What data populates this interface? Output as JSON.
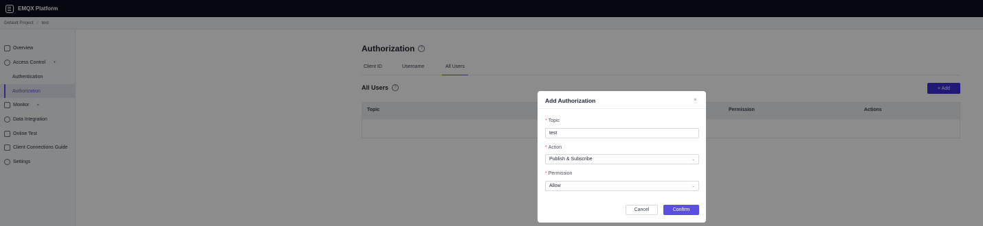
{
  "app": {
    "brand": "EMQX Platform"
  },
  "breadcrumb": [
    "Default Project",
    "test"
  ],
  "sidebar": {
    "items": [
      {
        "label": "Overview",
        "icon": "overview-icon"
      },
      {
        "label": "Access Control",
        "icon": "shield-icon",
        "caret": "▾"
      },
      {
        "label": "Authentication"
      },
      {
        "label": "Authorization",
        "active": true
      },
      {
        "label": "Monitor",
        "icon": "monitor-icon",
        "caret": "▸"
      },
      {
        "label": "Data Integration",
        "icon": "integration-icon"
      },
      {
        "label": "Online Test",
        "icon": "test-icon"
      },
      {
        "label": "Client Connections Guide",
        "icon": "guide-icon"
      },
      {
        "label": "Settings",
        "icon": "gear-icon"
      }
    ]
  },
  "main": {
    "title": "Authorization",
    "help_glyph": "?",
    "tabs": [
      {
        "label": "Client ID"
      },
      {
        "label": "Username"
      },
      {
        "label": "All Users",
        "active": true
      }
    ],
    "section_title": "All Users",
    "add_label": "+ Add",
    "table_headers": [
      "Topic",
      "Permission",
      "Actions"
    ]
  },
  "modal": {
    "title": "Add Authorization",
    "close": "×",
    "fields": [
      {
        "label": "Topic",
        "value": "test",
        "required": "*"
      },
      {
        "label": "Action",
        "value": "Publish & Subscribe",
        "required": "*",
        "chevron": "⌄"
      },
      {
        "label": "Permission",
        "value": "Allow",
        "required": "*",
        "chevron": "⌄"
      }
    ],
    "cancel_label": "Cancel",
    "confirm_label": "Confirm"
  },
  "colors": {
    "accent": "#5b4fe0",
    "topbar": "#0b0d1c",
    "required": "#e5484d"
  }
}
